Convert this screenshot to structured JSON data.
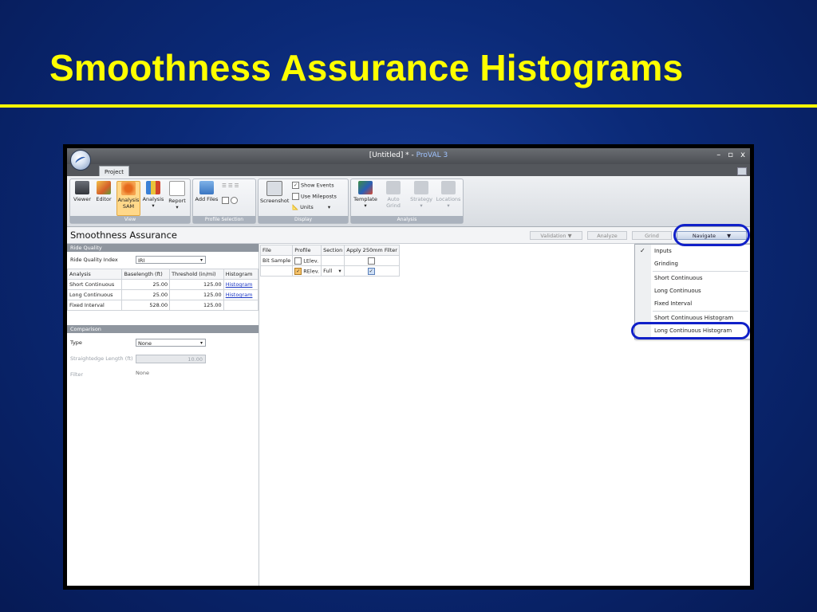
{
  "slide": {
    "title": "Smoothness Assurance Histograms"
  },
  "window": {
    "title_prefix": "[Untitled] * - ",
    "app_name": "ProVAL 3",
    "buttons": [
      "–",
      "▫",
      "x"
    ]
  },
  "ribbon": {
    "tab": "Project",
    "view": {
      "viewer": "Viewer",
      "editor": "Editor",
      "analysis_sam_1": "Analysis",
      "analysis_sam_2": "SAM",
      "analysis": "Analysis",
      "analysis_arrow": "▾",
      "report": "Report",
      "report_arrow": "▾",
      "label": "View"
    },
    "profile": {
      "add_files": "Add Files",
      "label": "Profile Selection"
    },
    "display": {
      "screenshot": "Screenshot",
      "show_events": "Show Events",
      "use_mileposts": "Use Mileposts",
      "units": "Units",
      "label": "Display"
    },
    "analysis_group": {
      "template": "Template",
      "auto_grind": "Auto Grind",
      "strategy": "Strategy",
      "locations": "Locations",
      "label": "Analysis"
    }
  },
  "header": {
    "title": "Smoothness Assurance",
    "validation": "Validation",
    "analyze": "Analyze",
    "grind": "Grind",
    "navigate": "Navigate"
  },
  "ride_quality": {
    "section": "Ride Quality",
    "index_label": "Ride Quality Index",
    "index_value": "IRI",
    "columns": [
      "Analysis",
      "Baselength (ft)",
      "Threshold (in/mi)",
      "Histogram"
    ],
    "rows": [
      {
        "analysis": "Short Continuous",
        "baselength": "25.00",
        "threshold": "125.00",
        "histogram": "Histogram"
      },
      {
        "analysis": "Long Continuous",
        "baselength": "25.00",
        "threshold": "125.00",
        "histogram": "Histogram"
      },
      {
        "analysis": "Fixed Interval",
        "baselength": "528.00",
        "threshold": "125.00",
        "histogram": ""
      }
    ]
  },
  "comparison": {
    "section": "Comparison",
    "type_label": "Type",
    "type_value": "None",
    "straightedge_label": "Straightedge Length (ft)",
    "straightedge_value": "10.00",
    "filter_label": "Filter",
    "filter_value": "None"
  },
  "files": {
    "columns": [
      "File",
      "Profile",
      "Section",
      "Apply 250mm Filter"
    ],
    "rows": [
      {
        "file": "Bit Sample",
        "profile": "LElev.",
        "profile_checked": false,
        "section": "",
        "filter_checked": false
      },
      {
        "file": "",
        "profile": "RElev.",
        "profile_checked": true,
        "section": "Full",
        "filter_checked": true
      }
    ]
  },
  "navigate_menu": {
    "items": [
      "Inputs",
      "Grinding",
      "Short Continuous",
      "Long Continuous",
      "Fixed Interval",
      "Short Continuous Histogram",
      "Long Continuous Histogram"
    ],
    "checked": "Inputs"
  },
  "colors": {
    "title": "#ffff00",
    "background": "#0b2a78",
    "highlight_ring": "#1020c8"
  }
}
